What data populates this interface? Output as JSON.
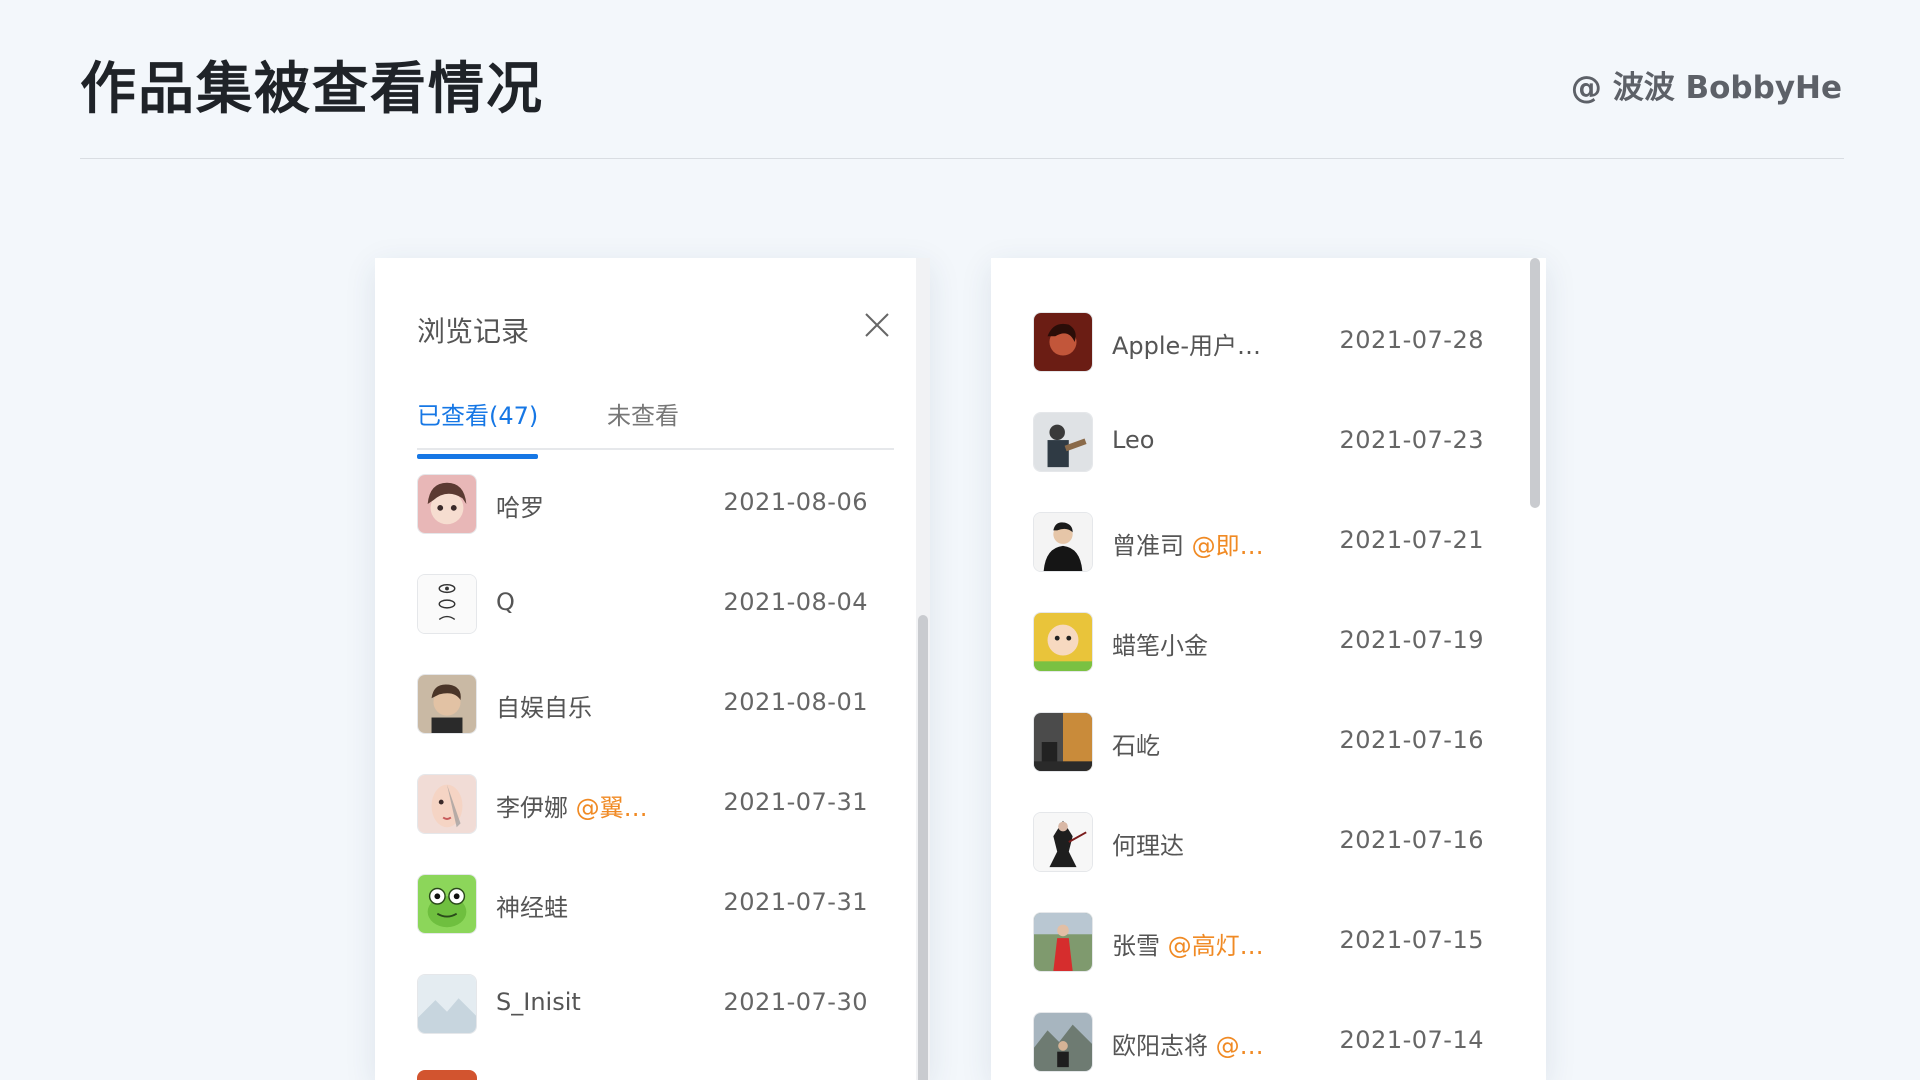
{
  "page": {
    "title": "作品集被查看情况",
    "author": "@ 波波 BobbyHe"
  },
  "browse_panel": {
    "title": "浏览记录",
    "tabs": [
      {
        "label": "已查看(47)",
        "active": true
      },
      {
        "label": "未查看",
        "active": false
      }
    ],
    "viewed": [
      {
        "name": "哈罗",
        "mention": "",
        "date": "2021-08-06",
        "avatar": "anime-girl"
      },
      {
        "name": "Q",
        "mention": "",
        "date": "2021-08-04",
        "avatar": "eye-sketch"
      },
      {
        "name": "自娱自乐",
        "mention": "",
        "date": "2021-08-01",
        "avatar": "man-portrait"
      },
      {
        "name": "李伊娜 ",
        "mention": "@翼…",
        "date": "2021-07-31",
        "avatar": "woman-face"
      },
      {
        "name": "神经蛙",
        "mention": "",
        "date": "2021-07-31",
        "avatar": "frog"
      },
      {
        "name": "S_Inisit",
        "mention": "",
        "date": "2021-07-30",
        "avatar": "landscape-placeholder"
      }
    ],
    "viewed_continued": [
      {
        "name": "Apple-用户…",
        "mention": "",
        "date": "2021-07-28",
        "avatar": "red-portrait"
      },
      {
        "name": "Leo",
        "mention": "",
        "date": "2021-07-23",
        "avatar": "guitar-man"
      },
      {
        "name": "曾准司 ",
        "mention": "@即…",
        "date": "2021-07-21",
        "avatar": "man-black-shirt"
      },
      {
        "name": "蜡笔小金",
        "mention": "",
        "date": "2021-07-19",
        "avatar": "baby"
      },
      {
        "name": "石屹",
        "mention": "",
        "date": "2021-07-16",
        "avatar": "street-scene"
      },
      {
        "name": "何理达",
        "mention": "",
        "date": "2021-07-16",
        "avatar": "ink-figure"
      },
      {
        "name": "张雪 ",
        "mention": "@高灯…",
        "date": "2021-07-15",
        "avatar": "woman-red-dress"
      },
      {
        "name": "欧阳志将 ",
        "mention": "@…",
        "date": "2021-07-14",
        "avatar": "mountain-man"
      }
    ]
  },
  "colors": {
    "accent": "#1677e5",
    "mention": "#f08a24",
    "background": "#f3f7fb"
  }
}
